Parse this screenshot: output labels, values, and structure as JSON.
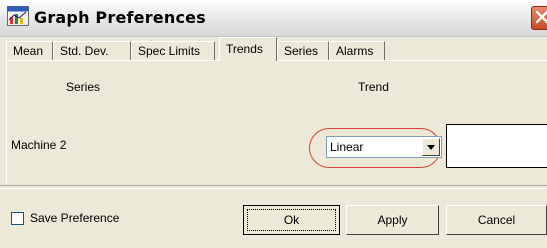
{
  "window": {
    "title": "Graph Preferences"
  },
  "tabs": [
    {
      "label": "Mean",
      "active": false
    },
    {
      "label": "Std. Dev.",
      "active": false
    },
    {
      "label": "Spec Limits",
      "active": false
    },
    {
      "label": "Trends",
      "active": true
    },
    {
      "label": "Series",
      "active": false
    },
    {
      "label": "Alarms",
      "active": false
    }
  ],
  "panel": {
    "series_header": "Series",
    "trend_header": "Trend",
    "row": {
      "series_name": "Machine 2",
      "trend_value": "Linear"
    }
  },
  "footer": {
    "save_preference_label": "Save Preference",
    "save_preference_checked": false,
    "ok_label": "Ok",
    "apply_label": "Apply",
    "cancel_label": "Cancel"
  },
  "colors": {
    "highlight_ellipse": "#d9433a",
    "close_button": "#c74a24"
  }
}
